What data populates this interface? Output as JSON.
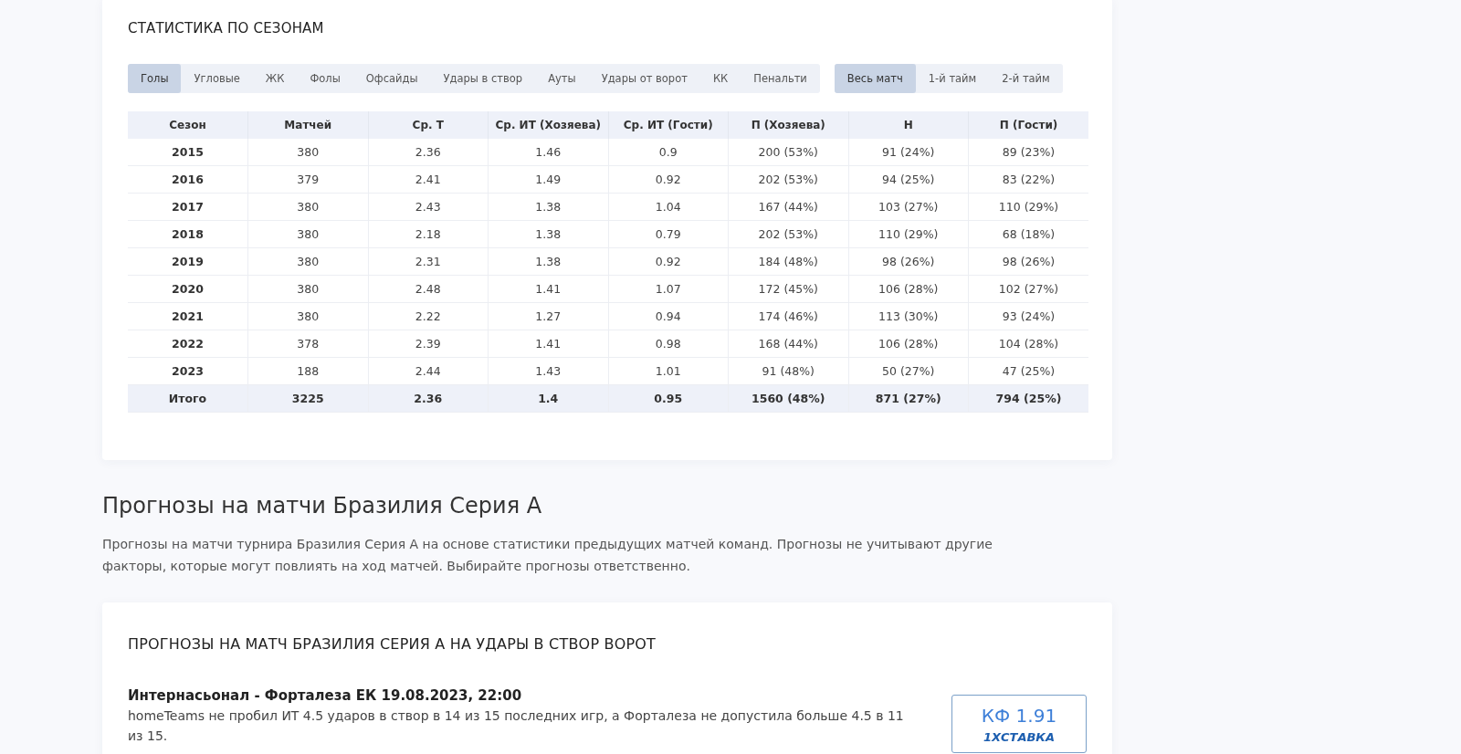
{
  "season_stats": {
    "title": "СТАТИСТИКА ПО СЕЗОНАМ",
    "stat_tabs": [
      {
        "label": "Голы",
        "selected": true
      },
      {
        "label": "Угловые",
        "selected": false
      },
      {
        "label": "ЖК",
        "selected": false
      },
      {
        "label": "Фолы",
        "selected": false
      },
      {
        "label": "Офсайды",
        "selected": false
      },
      {
        "label": "Удары в створ",
        "selected": false
      },
      {
        "label": "Ауты",
        "selected": false
      },
      {
        "label": "Удары от ворот",
        "selected": false
      },
      {
        "label": "КК",
        "selected": false
      },
      {
        "label": "Пенальти",
        "selected": false
      }
    ],
    "period_tabs": [
      {
        "label": "Весь матч",
        "selected": true
      },
      {
        "label": "1-й тайм",
        "selected": false
      },
      {
        "label": "2-й тайм",
        "selected": false
      }
    ],
    "table": {
      "columns": [
        "Сезон",
        "Матчей",
        "Ср. Т",
        "Ср. ИТ (Хозяева)",
        "Ср. ИТ (Гости)",
        "П (Хозяева)",
        "Н",
        "П (Гости)"
      ],
      "rows": [
        [
          "2015",
          "380",
          "2.36",
          "1.46",
          "0.9",
          "200 (53%)",
          "91 (24%)",
          "89 (23%)"
        ],
        [
          "2016",
          "379",
          "2.41",
          "1.49",
          "0.92",
          "202 (53%)",
          "94 (25%)",
          "83 (22%)"
        ],
        [
          "2017",
          "380",
          "2.43",
          "1.38",
          "1.04",
          "167 (44%)",
          "103 (27%)",
          "110 (29%)"
        ],
        [
          "2018",
          "380",
          "2.18",
          "1.38",
          "0.79",
          "202 (53%)",
          "110 (29%)",
          "68 (18%)"
        ],
        [
          "2019",
          "380",
          "2.31",
          "1.38",
          "0.92",
          "184 (48%)",
          "98 (26%)",
          "98 (26%)"
        ],
        [
          "2020",
          "380",
          "2.48",
          "1.41",
          "1.07",
          "172 (45%)",
          "106 (28%)",
          "102 (27%)"
        ],
        [
          "2021",
          "380",
          "2.22",
          "1.27",
          "0.94",
          "174 (46%)",
          "113 (30%)",
          "93 (24%)"
        ],
        [
          "2022",
          "378",
          "2.39",
          "1.41",
          "0.98",
          "168 (44%)",
          "106 (28%)",
          "104 (28%)"
        ],
        [
          "2023",
          "188",
          "2.44",
          "1.43",
          "1.01",
          "91 (48%)",
          "50 (27%)",
          "47 (25%)"
        ]
      ],
      "total": [
        "Итого",
        "3225",
        "2.36",
        "1.4",
        "0.95",
        "1560 (48%)",
        "871 (27%)",
        "794 (25%)"
      ]
    }
  },
  "predictions_section": {
    "heading": "Прогнозы на матчи Бразилия Серия А",
    "description": "Прогнозы на матчи турнира Бразилия Серия А на основе статистики предыдущих матчей команд. Прогнозы не учитывают другие факторы, которые могут повлиять на ход матчей. Выбирайте прогнозы ответственно."
  },
  "predictions_card": {
    "title": "ПРОГНОЗЫ НА МАТЧ БРАЗИЛИЯ СЕРИЯ А НА УДАРЫ В СТВОР ВОРОТ",
    "items": [
      {
        "match": "Интернасьонал - Форталеза ЕК 19.08.2023, 22:00",
        "text": "homeTeams не пробил ИТ 4.5 ударов в створ в 14 из 15 последних игр, а Форталеза не допустила больше 4.5 в 11 из 15.",
        "odds": "КФ 1.91",
        "bookmaker": "1ХСТАВКА"
      }
    ]
  }
}
